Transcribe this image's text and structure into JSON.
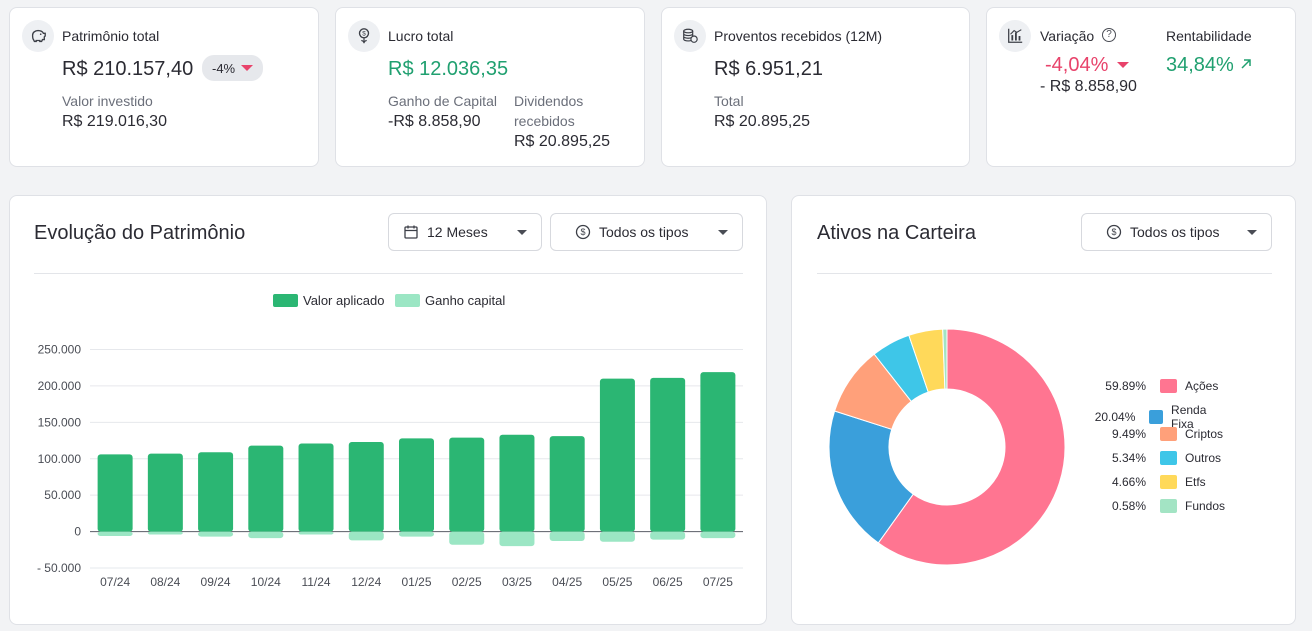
{
  "summary": {
    "patrimonio": {
      "title": "Patrimônio total",
      "value": "R$ 210.157,40",
      "badge": "-4%",
      "sub_label": "Valor investido",
      "sub_value": "R$ 219.016,30"
    },
    "lucro": {
      "title": "Lucro total",
      "value": "R$ 12.036,35",
      "ganho_label": "Ganho de Capital",
      "ganho_value": "-R$ 8.858,90",
      "div_label_1": "Dividendos",
      "div_label_2": "recebidos",
      "div_value": "R$ 20.895,25"
    },
    "proventos": {
      "title": "Proventos recebidos (12M)",
      "value": "R$ 6.951,21",
      "sub_label": "Total",
      "sub_value": "R$ 20.895,25"
    },
    "variacao": {
      "title": "Variação",
      "value": "-4,04%",
      "sub_value": "- R$ 8.858,90",
      "rent_title": "Rentabilidade",
      "rent_value": "34,84%"
    }
  },
  "evolucao": {
    "title": "Evolução do Patrimônio",
    "period_select": "12 Meses",
    "type_select": "Todos os tipos"
  },
  "ativos": {
    "title": "Ativos na Carteira",
    "type_select": "Todos os tipos"
  },
  "colors": {
    "aplicado": "#2bb673",
    "ganho": "#9be6c4",
    "acoes": "#ff7591",
    "renda_fixa": "#3a9fdb",
    "criptos": "#ffa07a",
    "outros": "#3ec6e8",
    "etfs": "#ffd95a",
    "fundos": "#a3e4c4"
  },
  "chart_data": [
    {
      "type": "bar",
      "title": "",
      "legend": [
        "Valor aplicado",
        "Ganho capital"
      ],
      "legend_position": "top-center",
      "categories": [
        "07/24",
        "08/24",
        "09/24",
        "10/24",
        "11/24",
        "12/24",
        "01/25",
        "02/25",
        "03/25",
        "04/25",
        "05/25",
        "06/25",
        "07/25"
      ],
      "series": [
        {
          "name": "Valor aplicado",
          "values": [
            106000,
            107000,
            109000,
            118000,
            121000,
            123000,
            128000,
            129000,
            133000,
            131000,
            210000,
            211000,
            219000
          ]
        },
        {
          "name": "Ganho capital",
          "values": [
            -6000,
            -4000,
            -7000,
            -9000,
            -4000,
            -12000,
            -7000,
            -18000,
            -20000,
            -13000,
            -14000,
            -11000,
            -9000
          ]
        }
      ],
      "y_ticks": [
        "250.000",
        "200.000",
        "150.000",
        "100.000",
        "50.000",
        "0",
        "- 50.000"
      ],
      "ylim": [
        -50000,
        250000
      ],
      "grid": true
    },
    {
      "type": "pie",
      "donut": true,
      "legend_position": "right",
      "slices": [
        {
          "label": "Ações",
          "pct_label": "59.89%",
          "value": 59.89,
          "color_key": "acoes"
        },
        {
          "label": "Renda Fixa",
          "pct_label": "20.04%",
          "value": 20.04,
          "color_key": "renda_fixa"
        },
        {
          "label": "Criptos",
          "pct_label": "9.49%",
          "value": 9.49,
          "color_key": "criptos"
        },
        {
          "label": "Outros",
          "pct_label": "5.34%",
          "value": 5.34,
          "color_key": "outros"
        },
        {
          "label": "Etfs",
          "pct_label": "4.66%",
          "value": 4.66,
          "color_key": "etfs"
        },
        {
          "label": "Fundos",
          "pct_label": "0.58%",
          "value": 0.58,
          "color_key": "fundos"
        }
      ]
    }
  ]
}
